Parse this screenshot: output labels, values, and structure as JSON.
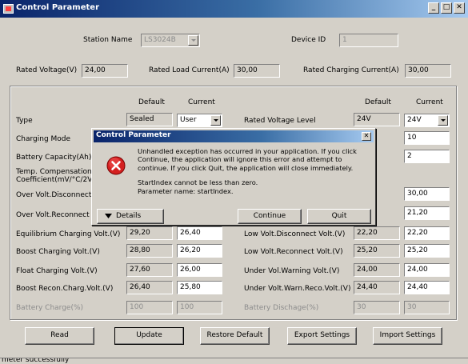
{
  "window": {
    "title": "Control Parameter",
    "min": "_",
    "max": "□",
    "close": "✕"
  },
  "top": {
    "station_name_label": "Station Name",
    "station_name_value": "LS3024B",
    "device_id_label": "Device ID",
    "device_id_value": "1",
    "rated_voltage_label": "Rated Voltage(V)",
    "rated_voltage_value": "24,00",
    "rated_load_label": "Rated Load Current(A)",
    "rated_load_value": "30,00",
    "rated_charging_label": "Rated Charging Current(A)",
    "rated_charging_value": "30,00"
  },
  "headers": {
    "default": "Default",
    "current": "Current"
  },
  "left": [
    {
      "label": "Type",
      "default": "Sealed",
      "current": "User"
    },
    {
      "label": "Charging Mode",
      "default": "",
      "current": ""
    },
    {
      "label": "Battery Capacity(Ah)",
      "default": "",
      "current": ""
    },
    {
      "label": "Temp. Compensation",
      "label2": "Coefficient(mV/°C/2V)",
      "default": "",
      "current": ""
    },
    {
      "label": "Over Volt.Disconnect Volt",
      "default": "",
      "current": ""
    },
    {
      "label": "Over Volt.Reconnect Volt",
      "default": "",
      "current": ""
    },
    {
      "label": "Equilibrium Charging Volt.(V)",
      "default": "29,20",
      "current": "26,40"
    },
    {
      "label": "Boost Charging Volt.(V)",
      "default": "28,80",
      "current": "26,20"
    },
    {
      "label": "Float Charging Volt.(V)",
      "default": "27,60",
      "current": "26,00"
    },
    {
      "label": "Boost Recon.Charg.Volt.(V)",
      "default": "26,40",
      "current": "25,80"
    },
    {
      "label": "Battery Charge(%)",
      "default": "100",
      "current": "100"
    }
  ],
  "right": [
    {
      "label": "Rated Voltage Level",
      "default": "24V",
      "current": "24V"
    },
    {
      "label": "",
      "default": "",
      "current": "10"
    },
    {
      "label": "",
      "default": "",
      "current": "2"
    },
    {
      "label": "",
      "default": "",
      "current": "30,00"
    },
    {
      "label": "",
      "default": "",
      "current": "21,20"
    },
    {
      "label": "Low Volt.Disconnect Volt.(V)",
      "default": "22,20",
      "current": "22,20"
    },
    {
      "label": "Low Volt.Reconnect Volt.(V)",
      "default": "25,20",
      "current": "25,20"
    },
    {
      "label": "Under Vol.Warning Volt.(V)",
      "default": "24,00",
      "current": "24,00"
    },
    {
      "label": "Under Volt.Warn.Reco.Volt.(V)",
      "default": "24,40",
      "current": "24,40"
    },
    {
      "label": "Battery Dischage(%)",
      "default": "30",
      "current": "30"
    }
  ],
  "buttons": {
    "read": "Read",
    "update": "Update",
    "restore": "Restore Default",
    "export": "Export Settings",
    "import": "Import Settings"
  },
  "status": "meter successfully",
  "dialog": {
    "title": "Control Parameter",
    "close": "✕",
    "message1": "Unhandled exception has occurred in your application. If you click Continue, the application will ignore this error and attempt to continue. If you click Quit, the application will close immediately.",
    "message2": "StartIndex cannot be less than zero.",
    "message3": "Parameter name: startIndex.",
    "details": "Details",
    "continue": "Continue",
    "quit": "Quit"
  }
}
